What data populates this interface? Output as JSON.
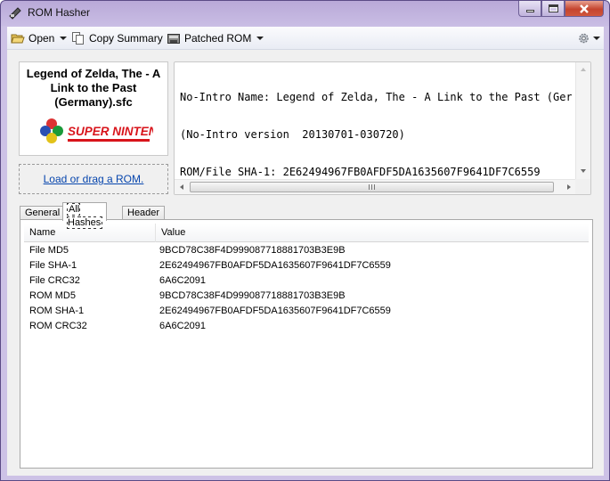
{
  "window": {
    "title": "ROM Hasher"
  },
  "toolbar": {
    "open_label": "Open",
    "copy_summary_label": "Copy Summary",
    "patched_rom_label": "Patched ROM"
  },
  "rom": {
    "file_name": "Legend of Zelda, The - A Link to the Past (Germany).sfc",
    "platform_logo_text": "SUPER NINTENDO",
    "load_link": "Load or drag a ROM."
  },
  "info": {
    "lines": [
      "No-Intro Name: Legend of Zelda, The - A Link to the Past (Germa",
      "(No-Intro version  20130701-030720)",
      "ROM/File SHA-1: 2E62494967FB0AFDF5DA1635607F9641DF7C6559"
    ]
  },
  "tabs": [
    "General",
    "All Hashes",
    "Header"
  ],
  "active_tab": "All Hashes",
  "hashes": {
    "columns": [
      "Name",
      "Value"
    ],
    "rows": [
      {
        "name": "File MD5",
        "value": "9BCD78C38F4D999087718881703B3E9B"
      },
      {
        "name": "File SHA-1",
        "value": "2E62494967FB0AFDF5DA1635607F9641DF7C6559"
      },
      {
        "name": "File CRC32",
        "value": "6A6C2091"
      },
      {
        "name": "ROM MD5",
        "value": "9BCD78C38F4D999087718881703B3E9B"
      },
      {
        "name": "ROM SHA-1",
        "value": "2E62494967FB0AFDF5DA1635607F9641DF7C6559"
      },
      {
        "name": "ROM CRC32",
        "value": "6A6C2091"
      }
    ]
  },
  "icons": [
    "app-icon",
    "open-icon",
    "copy-icon",
    "patch-icon",
    "gear-icon",
    "snes-logo"
  ],
  "colors": {
    "link": "#0645ad",
    "close_button": "#c4442e",
    "frame": "#c9bde4"
  }
}
